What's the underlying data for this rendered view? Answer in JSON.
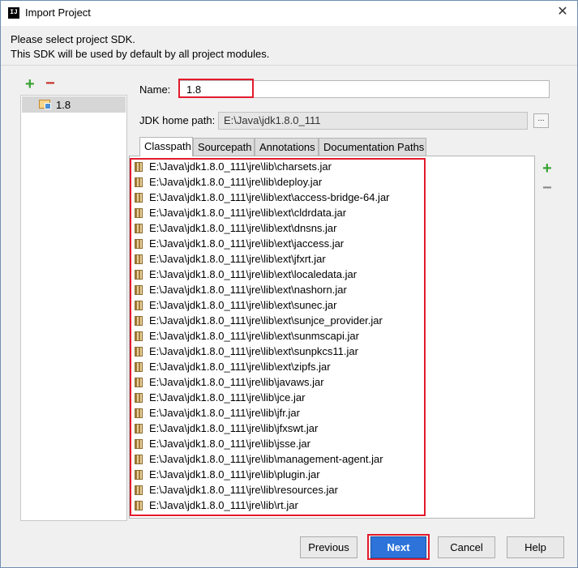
{
  "window": {
    "title": "Import Project",
    "close_glyph": "✕",
    "icon_text": "IJ"
  },
  "header": {
    "line1": "Please select project SDK.",
    "line2": "This SDK will be used by default by all project modules."
  },
  "sdk_list": {
    "items": [
      {
        "label": "1.8"
      }
    ]
  },
  "form": {
    "name_label": "Name:",
    "name_value": "1.8",
    "jdk_home_label": "JDK home path:",
    "jdk_home_value": "E:\\Java\\jdk1.8.0_111",
    "browse_label": "..."
  },
  "tabs": [
    {
      "label": "Classpath",
      "active": true
    },
    {
      "label": "Sourcepath",
      "active": false
    },
    {
      "label": "Annotations",
      "active": false
    },
    {
      "label": "Documentation Paths",
      "active": false
    }
  ],
  "classpath": [
    "E:\\Java\\jdk1.8.0_111\\jre\\lib\\charsets.jar",
    "E:\\Java\\jdk1.8.0_111\\jre\\lib\\deploy.jar",
    "E:\\Java\\jdk1.8.0_111\\jre\\lib\\ext\\access-bridge-64.jar",
    "E:\\Java\\jdk1.8.0_111\\jre\\lib\\ext\\cldrdata.jar",
    "E:\\Java\\jdk1.8.0_111\\jre\\lib\\ext\\dnsns.jar",
    "E:\\Java\\jdk1.8.0_111\\jre\\lib\\ext\\jaccess.jar",
    "E:\\Java\\jdk1.8.0_111\\jre\\lib\\ext\\jfxrt.jar",
    "E:\\Java\\jdk1.8.0_111\\jre\\lib\\ext\\localedata.jar",
    "E:\\Java\\jdk1.8.0_111\\jre\\lib\\ext\\nashorn.jar",
    "E:\\Java\\jdk1.8.0_111\\jre\\lib\\ext\\sunec.jar",
    "E:\\Java\\jdk1.8.0_111\\jre\\lib\\ext\\sunjce_provider.jar",
    "E:\\Java\\jdk1.8.0_111\\jre\\lib\\ext\\sunmscapi.jar",
    "E:\\Java\\jdk1.8.0_111\\jre\\lib\\ext\\sunpkcs11.jar",
    "E:\\Java\\jdk1.8.0_111\\jre\\lib\\ext\\zipfs.jar",
    "E:\\Java\\jdk1.8.0_111\\jre\\lib\\javaws.jar",
    "E:\\Java\\jdk1.8.0_111\\jre\\lib\\jce.jar",
    "E:\\Java\\jdk1.8.0_111\\jre\\lib\\jfr.jar",
    "E:\\Java\\jdk1.8.0_111\\jre\\lib\\jfxswt.jar",
    "E:\\Java\\jdk1.8.0_111\\jre\\lib\\jsse.jar",
    "E:\\Java\\jdk1.8.0_111\\jre\\lib\\management-agent.jar",
    "E:\\Java\\jdk1.8.0_111\\jre\\lib\\plugin.jar",
    "E:\\Java\\jdk1.8.0_111\\jre\\lib\\resources.jar",
    "E:\\Java\\jdk1.8.0_111\\jre\\lib\\rt.jar"
  ],
  "icons": {
    "add": "+",
    "remove": "−",
    "add_icon": "plus-icon",
    "remove_icon": "minus-icon",
    "jar_icon": "jar-icon",
    "folder_icon": "sdk-folder-icon"
  },
  "colors": {
    "add_green": "#3aa335",
    "remove_red": "#c8312a",
    "highlight_red": "#e21a2c",
    "primary_blue": "#2d73d9"
  },
  "buttons": {
    "previous": "Previous",
    "next": "Next",
    "cancel": "Cancel",
    "help": "Help"
  }
}
